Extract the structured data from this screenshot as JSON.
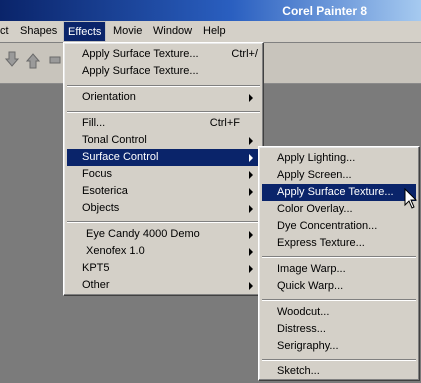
{
  "window": {
    "title": "Corel Painter 8"
  },
  "menubar": {
    "items": [
      {
        "label": "ct"
      },
      {
        "label": "Shapes"
      },
      {
        "label": "Effects"
      },
      {
        "label": "Movie"
      },
      {
        "label": "Window"
      },
      {
        "label": "Help"
      }
    ],
    "active": "Effects"
  },
  "effects_menu": {
    "items": [
      {
        "label": "Apply Surface Texture...",
        "shortcut": "Ctrl+/"
      },
      {
        "label": "Apply Surface Texture..."
      },
      {
        "label": "Orientation",
        "submenu": true
      },
      {
        "label": "Fill...",
        "shortcut": "Ctrl+F"
      },
      {
        "label": "Tonal Control",
        "submenu": true
      },
      {
        "label": "Surface Control",
        "submenu": true,
        "highlighted": true
      },
      {
        "label": "Focus",
        "submenu": true
      },
      {
        "label": "Esoterica",
        "submenu": true
      },
      {
        "label": "Objects",
        "submenu": true
      },
      {
        "label": "Eye Candy 4000 Demo",
        "submenu": true
      },
      {
        "label": "Xenofex 1.0",
        "submenu": true
      },
      {
        "label": "KPT5",
        "submenu": true
      },
      {
        "label": "Other",
        "submenu": true
      }
    ]
  },
  "surface_control_menu": {
    "items": [
      {
        "label": "Apply Lighting..."
      },
      {
        "label": "Apply Screen..."
      },
      {
        "label": "Apply Surface Texture...",
        "highlighted": true
      },
      {
        "label": "Color Overlay..."
      },
      {
        "label": "Dye Concentration..."
      },
      {
        "label": "Express Texture..."
      },
      {
        "label": "Image Warp..."
      },
      {
        "label": "Quick Warp..."
      },
      {
        "label": "Woodcut..."
      },
      {
        "label": "Distress..."
      },
      {
        "label": "Serigraphy..."
      },
      {
        "label": "Sketch..."
      }
    ]
  },
  "colors": {
    "highlight": "#0a246a",
    "menu_bg": "#d4d0c8",
    "workspace": "#7b7b7b"
  },
  "icons": [
    "stamp-down-icon",
    "stamp-up-icon",
    "tool-partial-icon",
    "mouse-pointer-icon",
    "submenu-arrow-icon"
  ]
}
